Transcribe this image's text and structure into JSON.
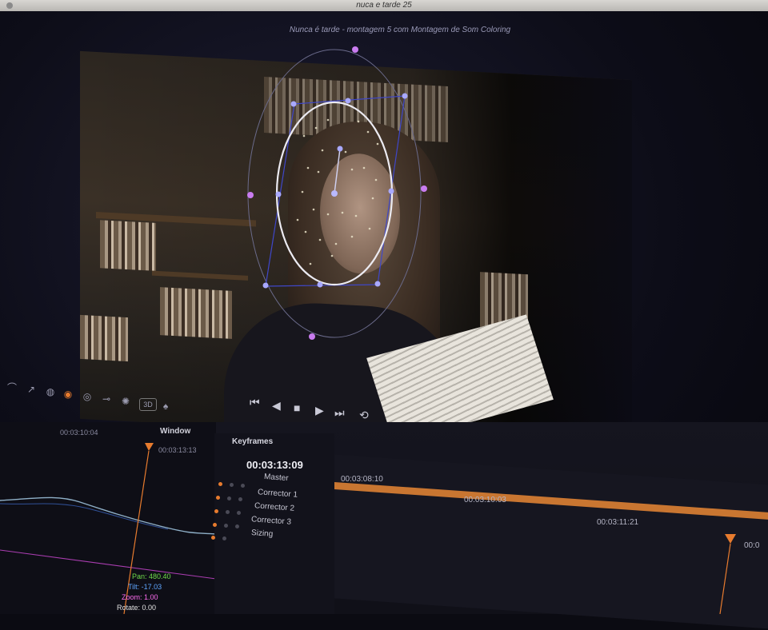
{
  "window": {
    "title": "nuca e tarde 25"
  },
  "viewer": {
    "title": "Nunca é tarde - montagem 5 com Montagem de Som Coloring"
  },
  "tools": {
    "icons": [
      "curves-icon",
      "pen-icon",
      "qualifier-icon",
      "color-wheel-icon",
      "power-window-icon",
      "tracker-icon",
      "blur-icon",
      "key-icon",
      "3d-icon",
      "sizing-icon"
    ],
    "label_3d": "3D"
  },
  "transport": {
    "icons": [
      "skip-back-icon",
      "reverse-play-icon",
      "stop-icon",
      "play-icon",
      "skip-forward-icon",
      "loop-icon"
    ]
  },
  "window_panel": {
    "header": "Window",
    "tc_left": "00:03:10:04",
    "tc_right": "00:03:13:13"
  },
  "keyframes": {
    "header": "Keyframes",
    "current_tc": "00:03:13:09",
    "rows": [
      {
        "label": "Master"
      },
      {
        "label": "Corrector 1"
      },
      {
        "label": "Corrector 2"
      },
      {
        "label": "Corrector 3"
      },
      {
        "label": "Sizing"
      }
    ],
    "timecodes": [
      "00:03:08:10",
      "00:03:10:03",
      "00:03:11:21",
      "00:0"
    ]
  },
  "readout": {
    "pan": "Pan: 480.40",
    "tilt": "Tilt: -17.03",
    "zoom": "Zoom: 1.00",
    "rotate": "Rotate: 0.00"
  },
  "colors": {
    "accent_orange": "#c97631",
    "tracker_purple": "#c97cf0",
    "tracker_blue": "#3f47c9",
    "pan_green": "#6fdc4a",
    "tilt_blue": "#5fa6ff",
    "zoom_magenta": "#ff6cf0"
  }
}
